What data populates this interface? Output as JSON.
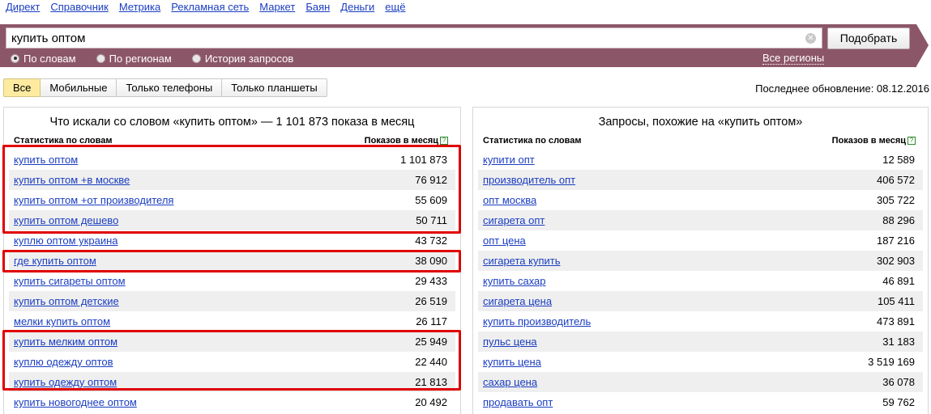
{
  "nav": [
    "Директ",
    "Справочник",
    "Метрика",
    "Рекламная сеть",
    "Маркет",
    "Баян",
    "Деньги",
    "ещё"
  ],
  "search": {
    "value": "купить оптом",
    "button": "Подобрать",
    "modes": [
      "По словам",
      "По регионам",
      "История запросов"
    ],
    "selected_mode": "По словам",
    "regions_link": "Все регионы"
  },
  "tabs": [
    "Все",
    "Мобильные",
    "Только телефоны",
    "Только планшеты"
  ],
  "active_tab": "Все",
  "updated": "Последнее обновление: 08.12.2016",
  "left_panel": {
    "title": "Что искали со словом «купить оптом» — 1 101 873 показа в месяц",
    "col_phrase": "Статистика по словам",
    "col_count": "Показов в месяц",
    "help_icon": "?",
    "rows": [
      {
        "phrase": "купить оптом",
        "count": "1 101 873"
      },
      {
        "phrase": "купить оптом +в москве",
        "count": "76 912"
      },
      {
        "phrase": "купить оптом +от производителя",
        "count": "55 609"
      },
      {
        "phrase": "купить оптом дешево",
        "count": "50 711"
      },
      {
        "phrase": "куплю оптом украина",
        "count": "43 732"
      },
      {
        "phrase": "где купить оптом",
        "count": "38 090"
      },
      {
        "phrase": "купить сигареты оптом",
        "count": "29 433"
      },
      {
        "phrase": "купить оптом детские",
        "count": "26 519"
      },
      {
        "phrase": "мелки купить оптом",
        "count": "26 117"
      },
      {
        "phrase": "купить мелким оптом",
        "count": "25 949"
      },
      {
        "phrase": "куплю одежду оптов",
        "count": "22 440"
      },
      {
        "phrase": "купить одежду оптом",
        "count": "21 813"
      },
      {
        "phrase": "купить новогоднее оптом",
        "count": "20 492"
      }
    ]
  },
  "right_panel": {
    "title": "Запросы, похожие на «купить оптом»",
    "col_phrase": "Статистика по словам",
    "col_count": "Показов в месяц",
    "help_icon": "?",
    "rows": [
      {
        "phrase": "купити опт",
        "count": "12 589"
      },
      {
        "phrase": "производитель опт",
        "count": "406 572"
      },
      {
        "phrase": "опт москва",
        "count": "305 722"
      },
      {
        "phrase": "сигарета опт",
        "count": "88 296"
      },
      {
        "phrase": "опт цена",
        "count": "187 216"
      },
      {
        "phrase": "сигарета купить",
        "count": "302 903"
      },
      {
        "phrase": "купить сахар",
        "count": "46 891"
      },
      {
        "phrase": "сигарета цена",
        "count": "105 411"
      },
      {
        "phrase": "купить производитель",
        "count": "473 891"
      },
      {
        "phrase": "пульс цена",
        "count": "31 183"
      },
      {
        "phrase": "купить цена",
        "count": "3 519 169"
      },
      {
        "phrase": "сахар цена",
        "count": "36 078"
      },
      {
        "phrase": "продавать опт",
        "count": "59 762"
      }
    ]
  },
  "colors": {
    "band": "#8c5669",
    "link": "#1a3dc1",
    "highlight": "#e00000",
    "active_tab": "#ffeba0"
  }
}
